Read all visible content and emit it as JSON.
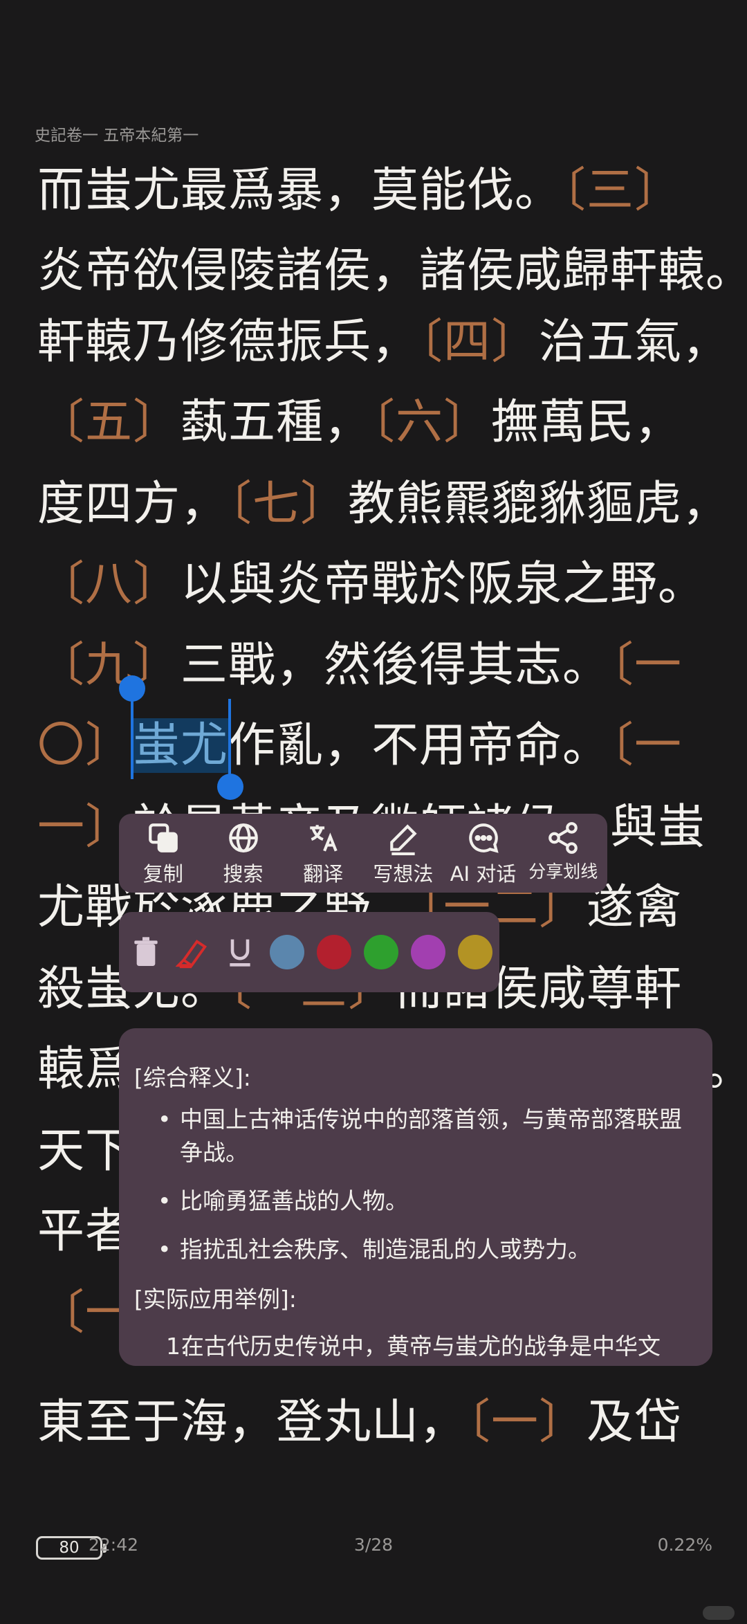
{
  "header": {
    "chapter_title": "史記卷一 五帝本紀第一"
  },
  "reader": {
    "lines": [
      [
        {
          "t": "而蚩尤最爲暴，莫能伐。"
        },
        {
          "t": "〔三〕",
          "note": true
        }
      ],
      [
        {
          "t": "炎帝欲侵陵諸侯，諸侯咸歸軒轅。"
        }
      ],
      [
        {
          "t": "軒轅乃修德振兵，"
        },
        {
          "t": "〔四〕",
          "note": true
        },
        {
          "t": "治五氣，"
        }
      ],
      [
        {
          "t": "〔五〕",
          "note": true
        },
        {
          "t": "蓺五種，"
        },
        {
          "t": "〔六〕",
          "note": true
        },
        {
          "t": "撫萬民，"
        }
      ],
      [
        {
          "t": "度四方，"
        },
        {
          "t": "〔七〕",
          "note": true
        },
        {
          "t": "教熊羆貔貅貙虎，"
        }
      ],
      [
        {
          "t": "〔八〕",
          "note": true
        },
        {
          "t": "以與炎帝戰於阪泉之野。"
        }
      ],
      [
        {
          "t": "〔九〕",
          "note": true
        },
        {
          "t": "三戰，然後得其志。"
        },
        {
          "t": "〔一",
          "note": true
        }
      ],
      [
        {
          "t": "〇〕",
          "note": true
        },
        {
          "t": "蚩尤",
          "sel": true
        },
        {
          "t": "作亂，不用帝命。"
        },
        {
          "t": "〔一",
          "note": true
        }
      ],
      [
        {
          "t": "一〕",
          "note": true
        },
        {
          "t": "於是黃帝乃徵師諸侯，與蚩"
        }
      ],
      [
        {
          "t": "尤戰於涿鹿之野，"
        },
        {
          "t": "〔一二〕",
          "note": true
        },
        {
          "t": "遂禽"
        }
      ],
      [
        {
          "t": "殺蚩尤。"
        },
        {
          "t": "〔一三〕",
          "note": true
        },
        {
          "t": "而諸侯咸尊軒"
        }
      ],
      [
        {
          "t": "轅爲天子，代神農氏，是爲黃帝。"
        }
      ],
      [
        {
          "t": "天下有不順者，黃帝從而征之，"
        }
      ],
      [
        {
          "t": "平者去之，"
        }
      ],
      [
        {
          "t": "〔一",
          "note": true
        }
      ],
      [
        {
          "t": "東至于海，登丸山，"
        },
        {
          "t": "〔一〕",
          "note": true
        },
        {
          "t": "及岱"
        }
      ]
    ]
  },
  "toolbar": {
    "buttons": [
      {
        "id": "copy",
        "label": "复制"
      },
      {
        "id": "search",
        "label": "搜索"
      },
      {
        "id": "translate",
        "label": "翻译"
      },
      {
        "id": "note",
        "label": "写想法"
      },
      {
        "id": "ai",
        "label": "AI 对话"
      },
      {
        "id": "share",
        "label": "分享划线"
      }
    ]
  },
  "palette": {
    "icons": [
      "trash-icon",
      "highlighter-icon",
      "underline-icon"
    ],
    "colors": [
      "#5b86ad",
      "#b3202e",
      "#2ea02e",
      "#a23fb0",
      "#b39324"
    ]
  },
  "popup": {
    "heading1": "[综合释义]:",
    "bullets": [
      "中国上古神话传说中的部落首领，与黄帝部落联盟争战。",
      "比喻勇猛善战的人物。",
      "指扰乱社会秩序、制造混乱的人或势力。"
    ],
    "heading2": "[实际应用举例]:",
    "example_number": "1.",
    "example_text": "在古代历史传说中，黄帝与蚩尤的战争是中华文"
  },
  "status_bar": {
    "battery": "80",
    "time": "22:42",
    "page": "3/28",
    "progress": "0.22%"
  }
}
